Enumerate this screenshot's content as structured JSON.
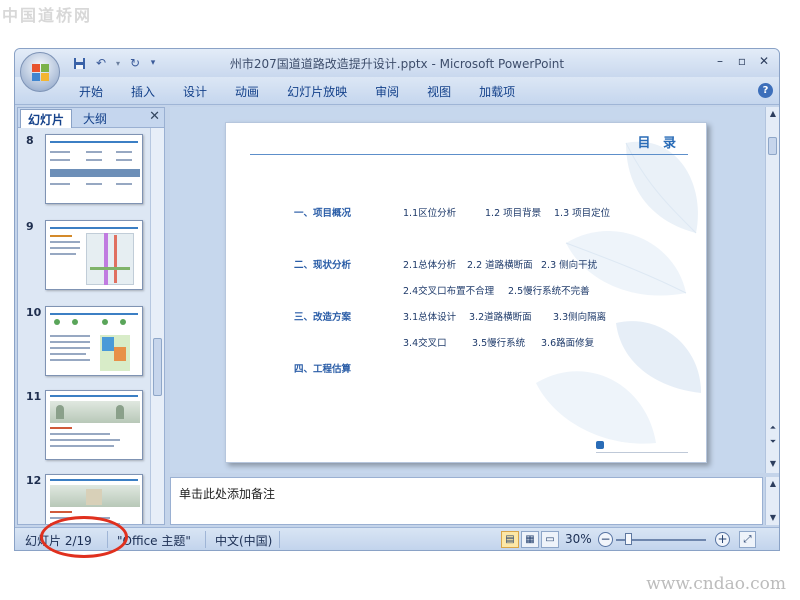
{
  "watermark": {
    "top_left": "中国道桥网",
    "bottom_right": "www.cndao.com"
  },
  "window": {
    "title": "州市207国道道路改造提升设计.pptx - Microsoft PowerPoint"
  },
  "ribbon_tabs": [
    "开始",
    "插入",
    "设计",
    "动画",
    "幻灯片放映",
    "审阅",
    "视图",
    "加载项"
  ],
  "left_pane": {
    "tabs": [
      "幻灯片",
      "大纲"
    ],
    "thumbnails": [
      {
        "number": "8"
      },
      {
        "number": "9"
      },
      {
        "number": "10"
      },
      {
        "number": "11"
      },
      {
        "number": "12"
      }
    ]
  },
  "slide": {
    "title": "目 录",
    "sections": [
      {
        "heading": "一、项目概况",
        "items": [
          "1.1区位分析",
          "1.2 项目背景",
          "1.3 项目定位"
        ]
      },
      {
        "heading": "二、现状分析",
        "items": [
          "2.1总体分析",
          "2.2 道路横断面",
          "2.3 侧向干扰",
          "2.4交叉口布置不合理",
          "2.5慢行系统不完善"
        ]
      },
      {
        "heading": "三、改造方案",
        "items": [
          "3.1总体设计",
          "3.2道路横断面",
          "3.3侧向隔离",
          "3.4交叉口",
          "3.5慢行系统",
          "3.6路面修复"
        ]
      },
      {
        "heading": "四、工程估算",
        "items": []
      }
    ]
  },
  "notes": {
    "placeholder": "单击此处添加备注"
  },
  "statusbar": {
    "slide_counter": "幻灯片 2/19",
    "theme": "\"Office 主题\"",
    "language": "中文(中国)",
    "zoom": "30%"
  },
  "colors": {
    "accent": "#2a6cb7",
    "annotation": "#e0301e",
    "window_bg": "#c4d4ea"
  }
}
